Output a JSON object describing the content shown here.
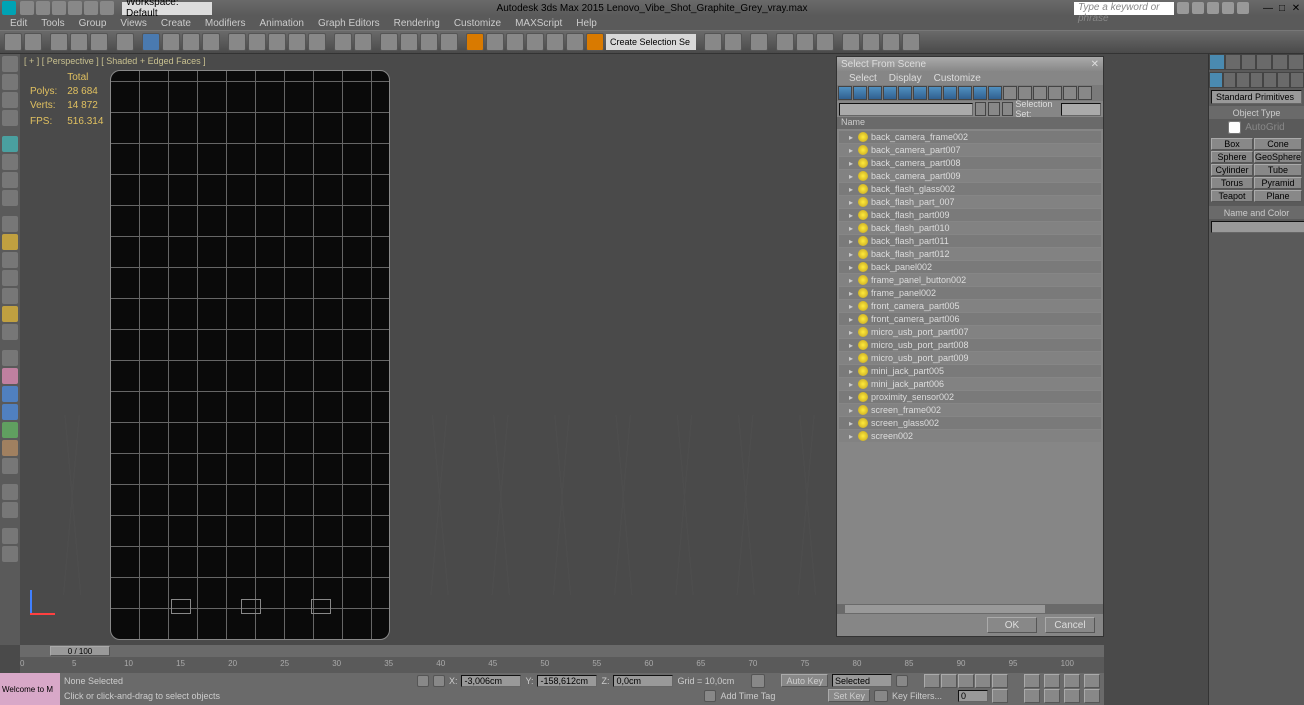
{
  "app": {
    "title": "Autodesk 3ds Max  2015    Lenovo_Vibe_Shot_Graphite_Grey_vray.max",
    "workspace": "Workspace: Default",
    "search_placeholder": "Type a keyword or phrase"
  },
  "menus": [
    "Edit",
    "Tools",
    "Group",
    "Views",
    "Create",
    "Modifiers",
    "Animation",
    "Graph Editors",
    "Rendering",
    "Customize",
    "MAXScript",
    "Help"
  ],
  "viewport": {
    "label": "[ + ] [ Perspective ] [ Shaded + Edged Faces ]",
    "stats": {
      "total_label": "Total",
      "polys_label": "Polys:",
      "polys": "28 684",
      "verts_label": "Verts:",
      "verts": "14 872",
      "fps_label": "FPS:",
      "fps": "516.314"
    }
  },
  "dialog": {
    "title": "Select From Scene",
    "menus": [
      "Select",
      "Display",
      "Customize"
    ],
    "selection_set_label": "Selection Set:",
    "header": "Name",
    "items": [
      "back_camera_frame002",
      "back_camera_part007",
      "back_camera_part008",
      "back_camera_part009",
      "back_flash_glass002",
      "back_flash_part_007",
      "back_flash_part009",
      "back_flash_part010",
      "back_flash_part011",
      "back_flash_part012",
      "back_panel002",
      "frame_panel_button002",
      "frame_panel002",
      "front_camera_part005",
      "front_camera_part006",
      "micro_usb_port_part007",
      "micro_usb_port_part008",
      "micro_usb_port_part009",
      "mini_jack_part005",
      "mini_jack_part006",
      "proximity_sensor002",
      "screen_frame002",
      "screen_glass002",
      "screen002"
    ],
    "ok": "OK",
    "cancel": "Cancel"
  },
  "cmdpanel": {
    "dropdown": "Standard Primitives",
    "object_type": "Object Type",
    "name_color": "Name and Color",
    "autogrid": "AutoGrid",
    "primitives": [
      "Box",
      "Cone",
      "Sphere",
      "GeoSphere",
      "Cylinder",
      "Tube",
      "Torus",
      "Pyramid",
      "Teapot",
      "Plane"
    ]
  },
  "timeline": {
    "slider": "0 / 100",
    "ticks": [
      "0",
      "5",
      "10",
      "15",
      "20",
      "25",
      "30",
      "35",
      "40",
      "45",
      "50",
      "55",
      "60",
      "65",
      "70",
      "75",
      "80",
      "85",
      "90",
      "95",
      "100"
    ]
  },
  "status": {
    "welcome": "Welcome to M",
    "selection": "None Selected",
    "prompt": "Click or click-and-drag to select objects",
    "x_label": "X:",
    "x": "-3,006cm",
    "y_label": "Y:",
    "y": "-158,612cm",
    "z_label": "Z:",
    "z": "0,0cm",
    "grid": "Grid = 10,0cm",
    "autokey": "Auto Key",
    "setkey": "Set Key",
    "selected": "Selected",
    "addtimetag": "Add Time Tag",
    "keyfilters": "Key Filters..."
  },
  "toolbar": {
    "selection_dropdown": "Create Selection Se"
  }
}
